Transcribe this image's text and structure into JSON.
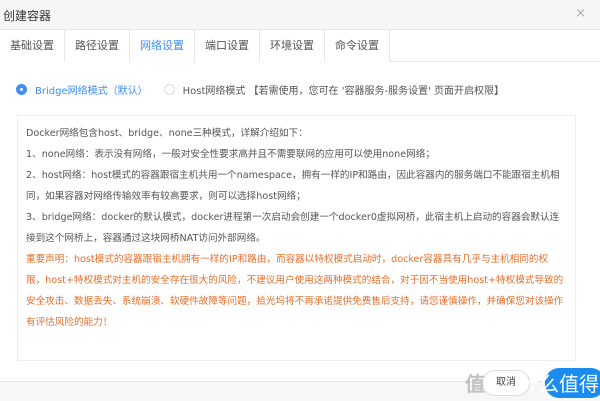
{
  "dialog": {
    "title": "创建容器",
    "close_icon": "×"
  },
  "tabs": [
    "基础设置",
    "路径设置",
    "网络设置",
    "端口设置",
    "环境设置",
    "命令设置"
  ],
  "active_tab": 2,
  "network": {
    "bridge_label": "Bridge网络模式（默认）",
    "host_label": "Host网络模式 【若需使用，您可在 '容器服务-服务设置' 页面开启权限】",
    "selected": "bridge"
  },
  "info": {
    "lines": [
      "Docker网络包含host、bridge、none三种模式，详解介绍如下：",
      "1、none网络：表示没有网络，一般对安全性要求高并且不需要联网的应用可以使用none网络；",
      "2、host网络：host模式的容器跟宿主机共用一个namespace，拥有一样的IP和路由，因此容器内的服务端口不能跟宿主机相同，如果容器对网络传输效率有较高要求，则可以选择host网络；",
      "3、bridge网络：docker的默认模式，docker进程第一次启动会创建一个docker0虚拟网桥，此宿主机上启动的容器会默认连接到这个网桥上，容器通过这块网桥NAT访问外部网络。"
    ],
    "warning": "重要声明：host模式的容器跟宿主机拥有一样的IP和路由，而容器以特权模式启动时，docker容器具有几乎与主机相同的权限，host+特权模式对主机的安全存在很大的风险，不建议用户使用这两种模式的结合，对于因不当使用host+特权模式导致的安全攻击、数据丢失、系统崩溃、软硬件故障等问题，拾光坞将不再承诺提供免费售后支持，请您谨慎操作，并确保您对该操作有评估风险的能力！"
  },
  "footer": {
    "cancel_label": "取消"
  },
  "watermark": {
    "left": "值",
    "right": "什么值得买"
  },
  "colors": {
    "accent": "#3d8ef5",
    "warning": "#e46f2c"
  }
}
